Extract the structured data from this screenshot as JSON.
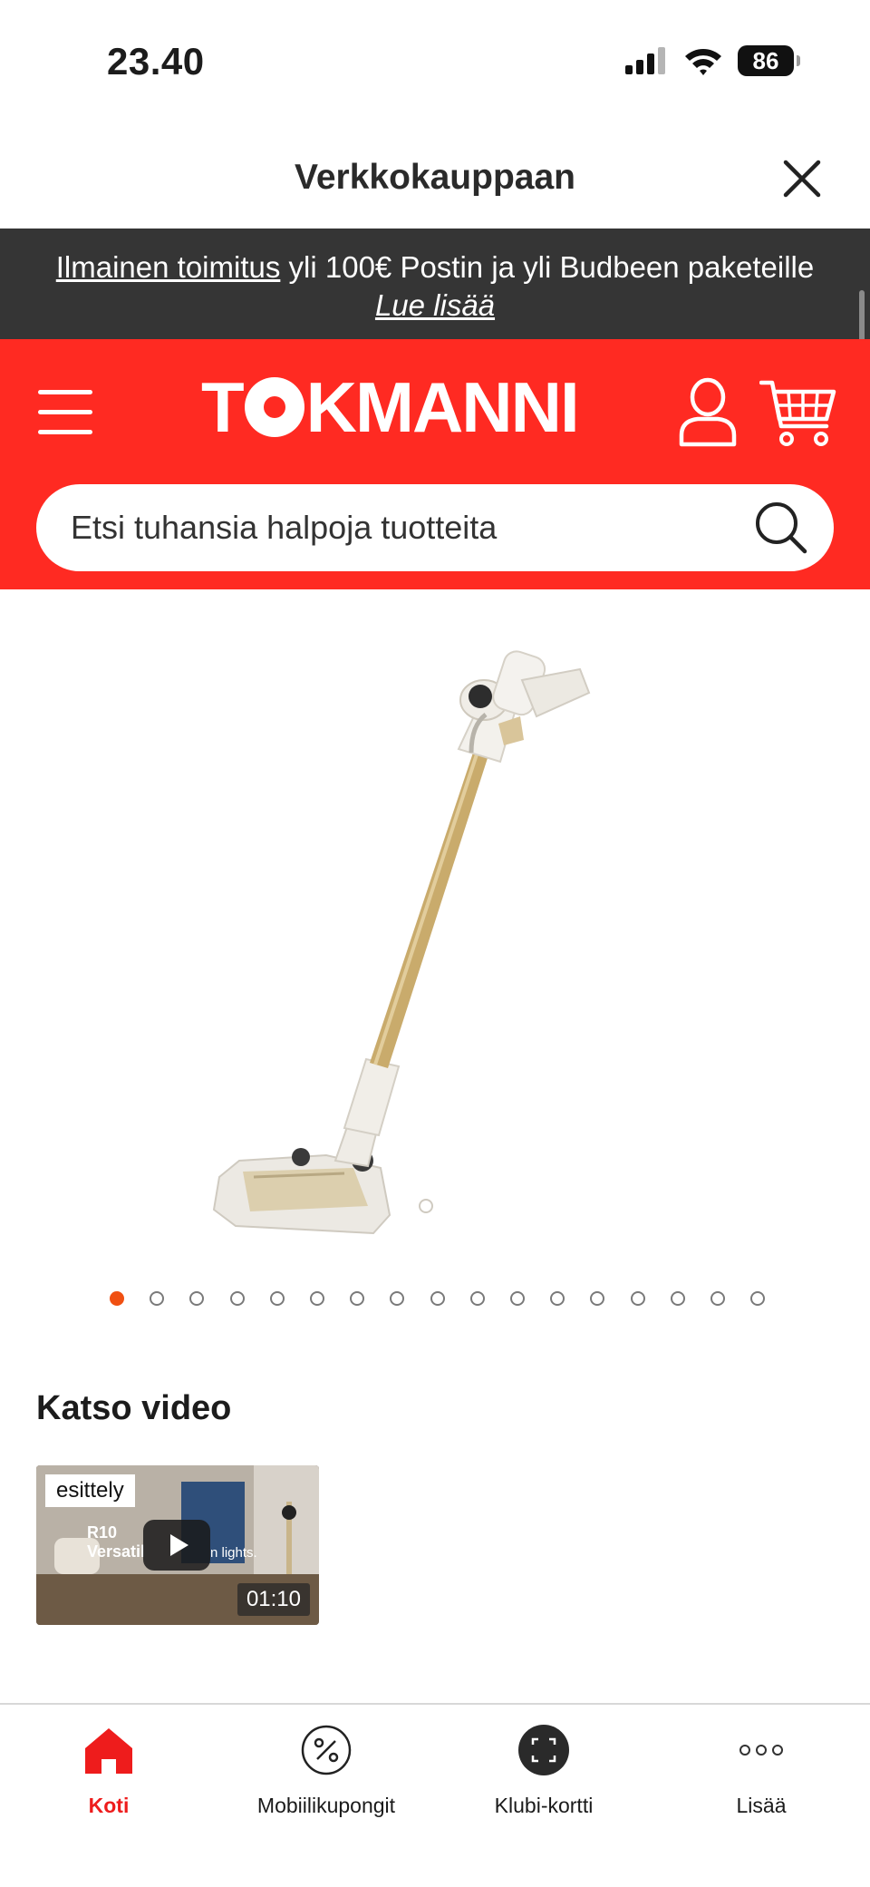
{
  "status_bar": {
    "time": "23.40",
    "battery": "86"
  },
  "title_bar": {
    "title": "Verkkokauppaan"
  },
  "promo": {
    "link_text": "Ilmainen toimitus",
    "text": " yli 100€ Postin ja yli Budbeen paketeille",
    "read_more": "Lue lisää"
  },
  "header": {
    "logo_text_left": "T",
    "logo_text_right": "KMANNI",
    "search_placeholder": "Etsi tuhansia halpoja tuotteita"
  },
  "carousel": {
    "total_images": 17,
    "active_index": 0
  },
  "video_section": {
    "heading": "Katso video",
    "video": {
      "tag": "esittely",
      "overlay_title": "R10",
      "overlay_left": "Versatil",
      "overlay_right": "n lights.",
      "duration": "01:10"
    }
  },
  "bottom_nav": {
    "items": [
      {
        "label": "Koti",
        "icon": "home-icon",
        "active": true
      },
      {
        "label": "Mobiilikupongit",
        "icon": "coupon-icon",
        "active": false
      },
      {
        "label": "Klubi-kortti",
        "icon": "scan-card-icon",
        "active": false
      },
      {
        "label": "Lisää",
        "icon": "more-icon",
        "active": false
      }
    ]
  },
  "colors": {
    "brand_red": "#ff2a22",
    "banner_dark": "#353535",
    "active_dot": "#f05012",
    "nav_active": "#ee1c1c"
  }
}
